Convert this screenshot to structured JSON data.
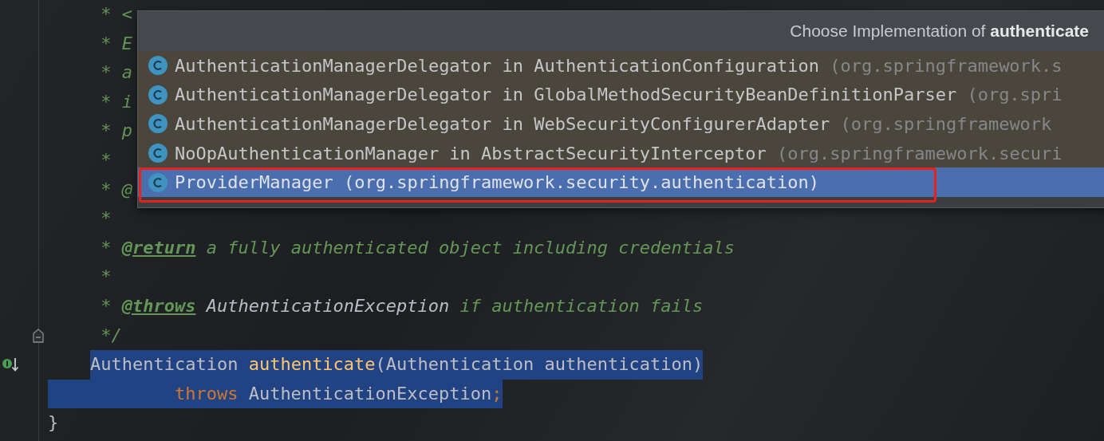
{
  "editor": {
    "lines": [
      {
        "tokens": [
          {
            "text": "     * <",
            "kind": "comment",
            "selected": false
          }
        ]
      },
      {
        "tokens": [
          {
            "text": "     * E",
            "kind": "comment",
            "selected": false
          }
        ]
      },
      {
        "tokens": [
          {
            "text": "     * a",
            "kind": "comment",
            "selected": false
          }
        ]
      },
      {
        "tokens": [
          {
            "text": "     * i",
            "kind": "comment",
            "selected": false
          }
        ]
      },
      {
        "tokens": [
          {
            "text": "     * p",
            "kind": "comment",
            "selected": false
          }
        ]
      },
      {
        "tokens": [
          {
            "text": "     *",
            "kind": "comment",
            "selected": false
          }
        ]
      },
      {
        "tokens": [
          {
            "text": "     * @",
            "kind": "comment",
            "selected": false
          }
        ]
      },
      {
        "tokens": [
          {
            "text": "     *",
            "kind": "comment",
            "selected": false
          }
        ]
      },
      {
        "tokens": [
          {
            "text": "     * ",
            "kind": "comment",
            "selected": false
          },
          {
            "text": "@return",
            "kind": "tag",
            "selected": false
          },
          {
            "text": " a fully authenticated object including credentials",
            "kind": "comment",
            "selected": false
          }
        ]
      },
      {
        "tokens": [
          {
            "text": "     *",
            "kind": "comment",
            "selected": false
          }
        ]
      },
      {
        "tokens": [
          {
            "text": "     * ",
            "kind": "comment",
            "selected": false
          },
          {
            "text": "@throws",
            "kind": "tag",
            "selected": false
          },
          {
            "text": " AuthenticationException",
            "kind": "docref",
            "selected": false
          },
          {
            "text": " if authentication fails",
            "kind": "comment",
            "selected": false
          }
        ]
      },
      {
        "kind": "doc_end",
        "tokens": [
          {
            "text": "     */",
            "kind": "comment",
            "selected": false
          }
        ]
      },
      {
        "kind": "signature",
        "tokens": [
          {
            "text": "Authentication ",
            "kind": "plain",
            "selected": true
          },
          {
            "text": "authenticate",
            "kind": "method",
            "selected": true
          },
          {
            "text": "(Authentication authentication)",
            "kind": "plain",
            "selected": true
          }
        ]
      },
      {
        "kind": "continuation",
        "tokens": [
          {
            "text": "throws ",
            "kind": "keyword",
            "selected": true
          },
          {
            "text": "AuthenticationException",
            "kind": "plain",
            "selected": true
          },
          {
            "text": ";",
            "kind": "keyword",
            "selected": true
          }
        ]
      },
      {
        "tokens": [
          {
            "text": "}",
            "kind": "plain",
            "selected": false
          }
        ]
      }
    ]
  },
  "popup": {
    "title": "Choose Implementation of **authenticate**",
    "items": [
      {
        "name": "AuthenticationManagerDelegator in AuthenticationConfiguration",
        "package": "(org.springframework.s",
        "selected": false,
        "annotated": false
      },
      {
        "name": "AuthenticationManagerDelegator in GlobalMethodSecurityBeanDefinitionParser",
        "package": "(org.spri",
        "selected": false,
        "annotated": false
      },
      {
        "name": "AuthenticationManagerDelegator in WebSecurityConfigurerAdapter",
        "package": "(org.springframework",
        "selected": false,
        "annotated": false
      },
      {
        "name": "NoOpAuthenticationManager in AbstractSecurityInterceptor",
        "package": "(org.springframework.securi",
        "selected": false,
        "annotated": false
      },
      {
        "name": "ProviderManager",
        "package": "(org.springframework.security.authentication)",
        "selected": true,
        "annotated": true
      }
    ]
  }
}
